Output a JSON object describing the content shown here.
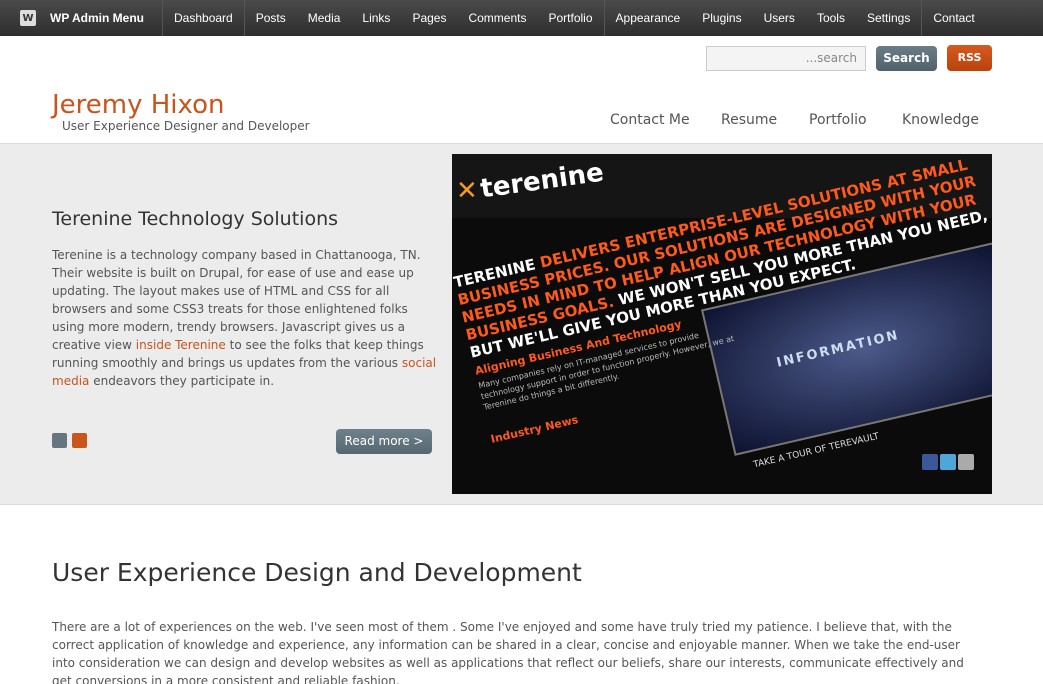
{
  "adminbar": {
    "brand": "WP Admin Menu",
    "items": [
      "Dashboard",
      "Posts",
      "Media",
      "Links",
      "Pages",
      "Comments",
      "Portfolio",
      "Appearance",
      "Plugins",
      "Users",
      "Tools",
      "Settings",
      "Contact"
    ]
  },
  "search": {
    "placeholder": "...search",
    "button": "Search"
  },
  "rss": "RSS",
  "site": {
    "title": "Jeremy Hixon",
    "tagline": "User Experience Designer and Developer"
  },
  "nav": [
    "Contact Me",
    "Resume",
    "Portfolio",
    "Knowledge"
  ],
  "feature": {
    "title": "Terenine Technology Solutions",
    "text_1": "Terenine is a technology company based in Chattanooga, TN. Their website is built on Drupal, for ease of use and ease up updating. The layout makes use of HTML and CSS for all browsers and some CSS3 treats for those enlightened folks using more modern, trendy browsers. Javascript gives us a creative view ",
    "link_1": "inside Terenine",
    "text_2": " to see the folks that keep things running smoothly and brings us updates from the various ",
    "link_2": "social media",
    "text_3": " endeavors they participate in.",
    "read_more": "Read more >",
    "dot_colors": [
      "#66757e",
      "#c9541c"
    ]
  },
  "screenshot": {
    "logo": "terenine",
    "headline_a": "TERENINE ",
    "headline_b": "DELIVERS ENTERPRISE-LEVEL SOLUTIONS AT SMALL BUSINESS PRICES. OUR SOLUTIONS ARE DESIGNED WITH YOUR NEEDS IN MIND TO HELP ALIGN OUR TECHNOLOGY WITH YOUR BUSINESS GOALS.",
    "headline_c": " WE WON'T SELL YOU MORE THAN YOU NEED, BUT WE'LL GIVE YOU MORE THAN YOU EXPECT.",
    "video_label": "INFORMATION",
    "col_heading": "Aligning Business And Technology",
    "col_text": "Many companies rely on IT-managed services to provide technology support in order to function properly. However, we at Terenine do things a bit differently.",
    "news_heading": "Industry News",
    "tour": "TAKE A TOUR OF TEREVAULT"
  },
  "section": {
    "title": "User Experience Design and Development",
    "text": "There are a lot of experiences on the web. I've seen most of them . Some I've enjoyed and some have truly tried my patience. I believe that, with the correct application of knowledge and experience, any information can be shared in a clear, concise and enjoyable manner. When we take the end-user into consideration we can design and develop websites as well as applications that reflect our beliefs, share our interests, communicate effectively and get conversions in a more consistent and reliable fashion."
  }
}
